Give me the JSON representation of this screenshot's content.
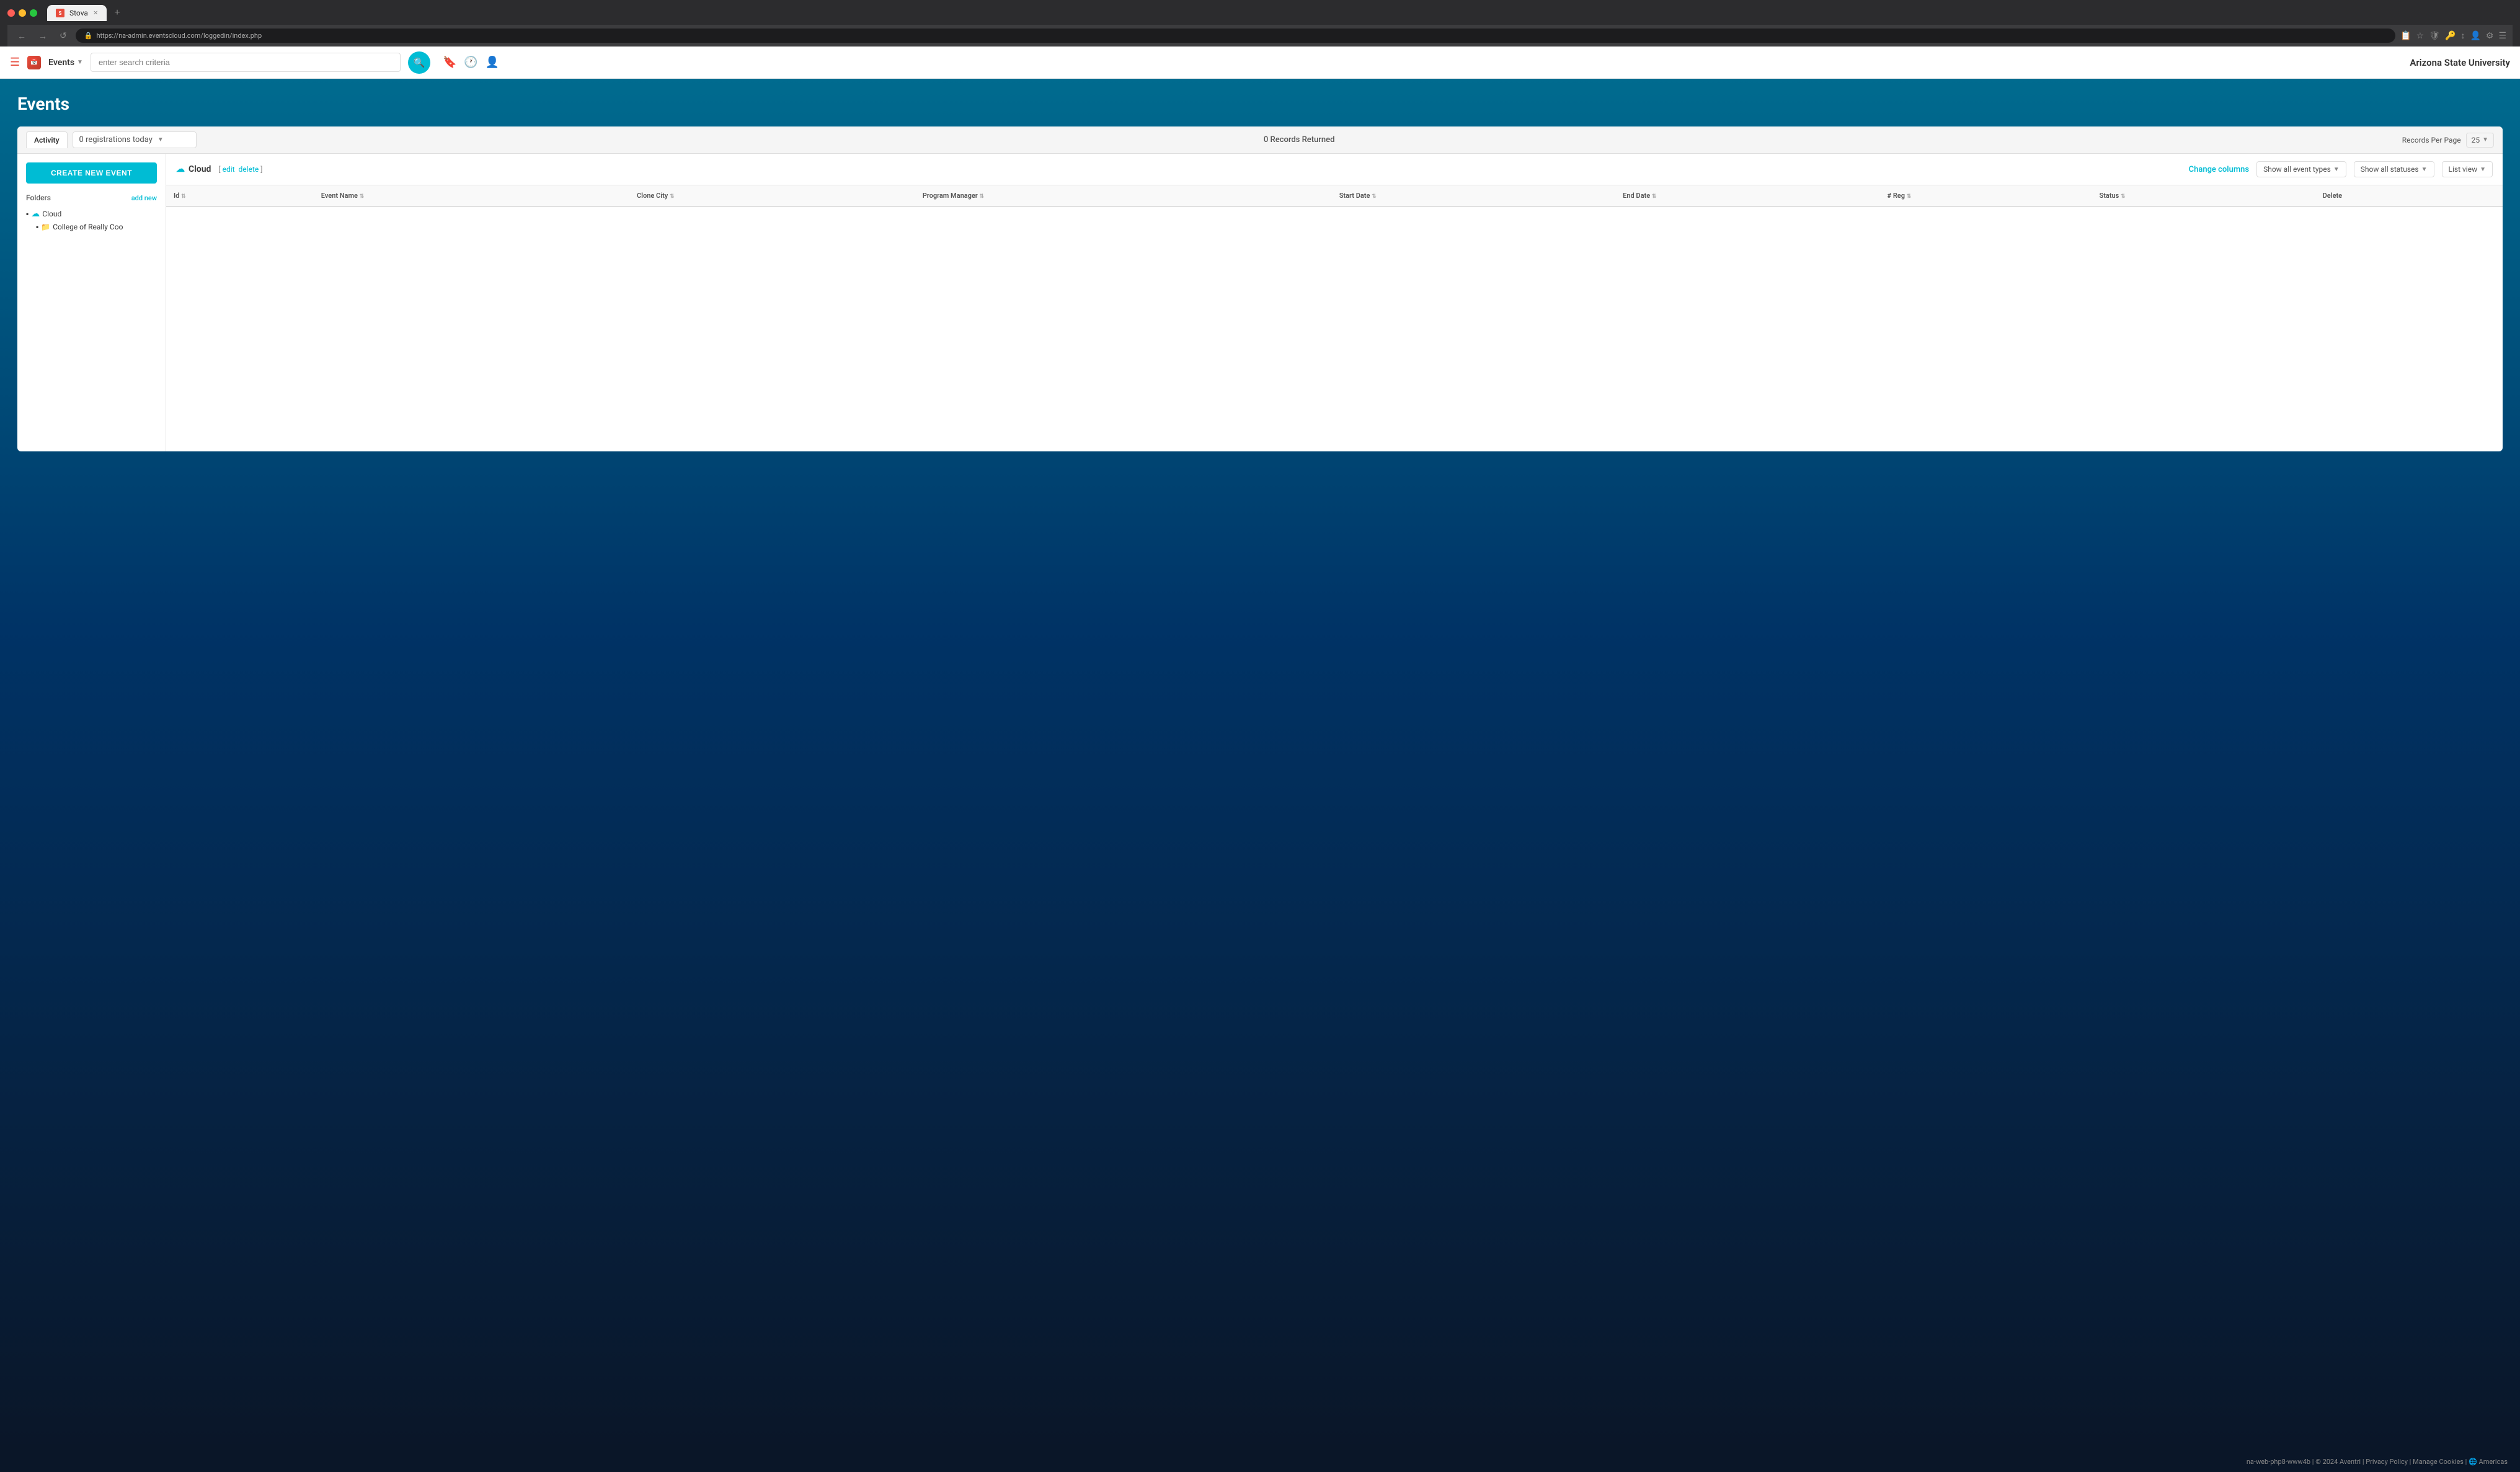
{
  "browser": {
    "url": "https://na-admin.eventscloud.com/loggedin/index.php",
    "tab_label": "Stova",
    "tab_favicon": "S"
  },
  "header": {
    "app_name": "Events",
    "search_placeholder": "enter search criteria",
    "org_name": "Arizona State University",
    "nav": {
      "back": "←",
      "forward": "→",
      "refresh": "↺"
    }
  },
  "page": {
    "title": "Events"
  },
  "activity_bar": {
    "tab_label": "Activity",
    "registrations": "0 registrations today",
    "records_returned": "0 Records Returned",
    "records_per_page_label": "Records Per Page",
    "per_page_value": "25"
  },
  "sidebar": {
    "create_btn_label": "CREATE NEW EVENT",
    "folders_label": "Folders",
    "add_new_label": "add new",
    "folder_items": [
      {
        "name": "Cloud",
        "level": 0,
        "type": "cloud"
      },
      {
        "name": "College of Really Coo",
        "level": 1,
        "type": "folder"
      }
    ]
  },
  "table_area": {
    "cloud_label": "Cloud",
    "edit_label": "edit",
    "delete_label": "delete",
    "change_columns_label": "Change columns",
    "show_event_types_label": "Show all event types",
    "show_statuses_label": "Show all statuses",
    "list_view_label": "List view",
    "columns": [
      {
        "key": "id",
        "label": "Id"
      },
      {
        "key": "event_name",
        "label": "Event Name"
      },
      {
        "key": "clone_city",
        "label": "Clone  City"
      },
      {
        "key": "program_manager",
        "label": "Program Manager"
      },
      {
        "key": "start_date",
        "label": "Start Date"
      },
      {
        "key": "end_date",
        "label": "End Date"
      },
      {
        "key": "num_reg",
        "label": "# Reg"
      },
      {
        "key": "status",
        "label": "Status"
      },
      {
        "key": "delete",
        "label": "Delete"
      }
    ],
    "rows": []
  },
  "footer": {
    "text": "na-web-php8-www4b | © 2024 Aventri | Privacy Policy | Manage Cookies | 🌐 Americas"
  }
}
